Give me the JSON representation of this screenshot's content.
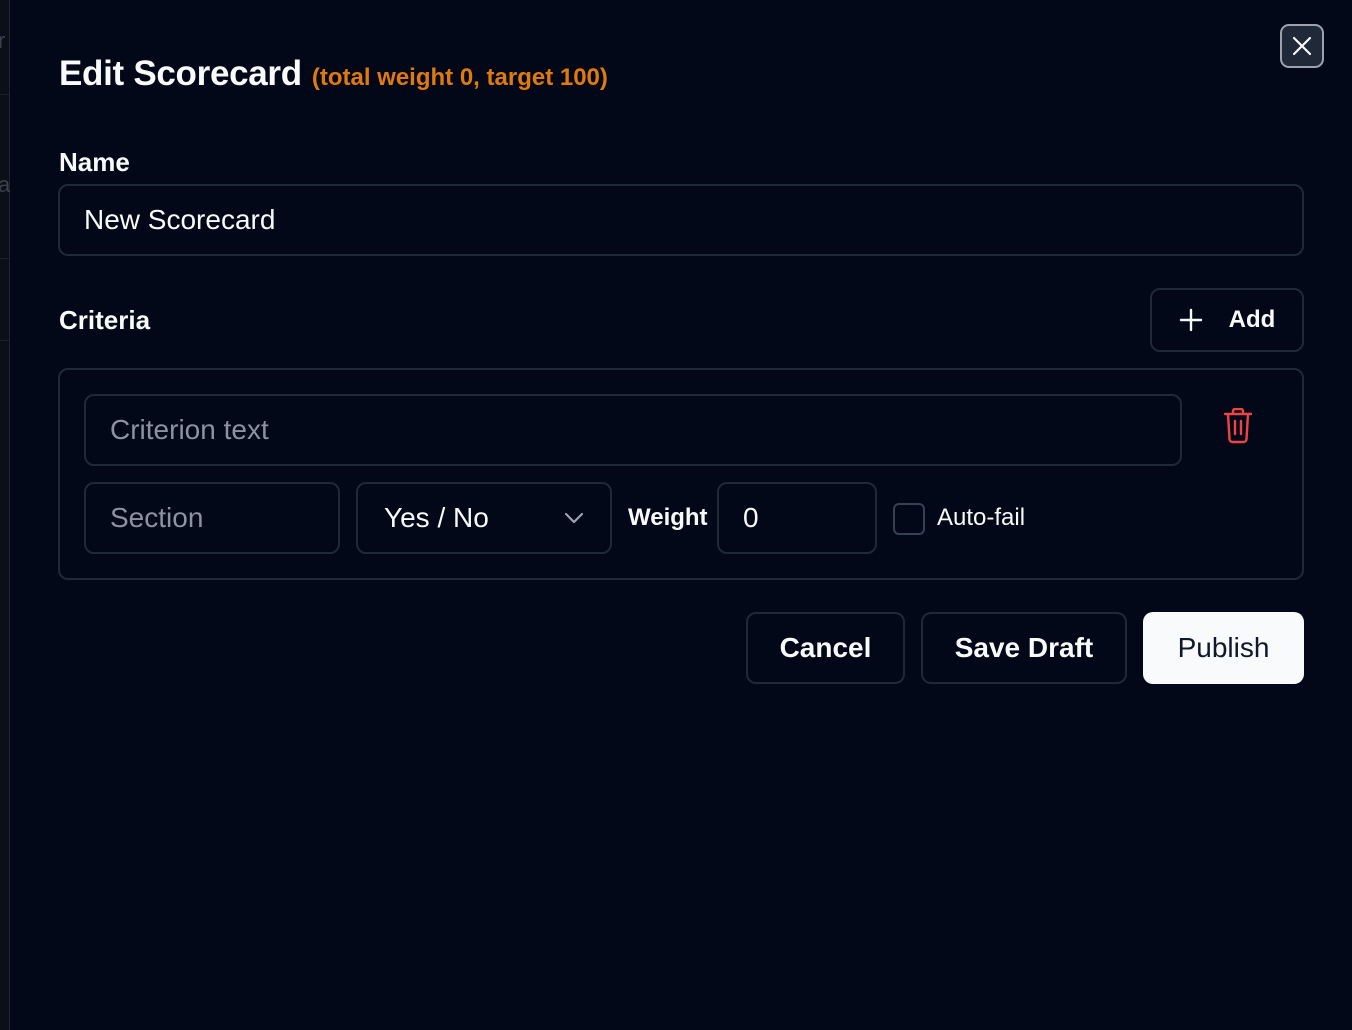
{
  "background_fragments": [
    "r",
    "a"
  ],
  "dialog": {
    "title": "Edit Scorecard",
    "subtitle": "(total weight 0, target 100)",
    "close_icon": "close-icon"
  },
  "name_field": {
    "label": "Name",
    "value": "New Scorecard"
  },
  "criteria": {
    "label": "Criteria",
    "add_label": "Add",
    "add_icon": "plus-icon",
    "items": [
      {
        "text_placeholder": "Criterion text",
        "text_value": "",
        "section_placeholder": "Section",
        "section_value": "",
        "type_value": "Yes / No",
        "weight_label": "Weight",
        "weight_value": "0",
        "autofail_label": "Auto-fail",
        "autofail_checked": false,
        "delete_icon": "trash-icon"
      }
    ]
  },
  "actions": {
    "cancel_label": "Cancel",
    "save_draft_label": "Save Draft",
    "publish_label": "Publish"
  },
  "colors": {
    "background": "#020817",
    "accent_orange": "#e07a0f",
    "danger_red": "#ef4444",
    "border": "#1f2937",
    "primary_button": "#f8fafc"
  }
}
